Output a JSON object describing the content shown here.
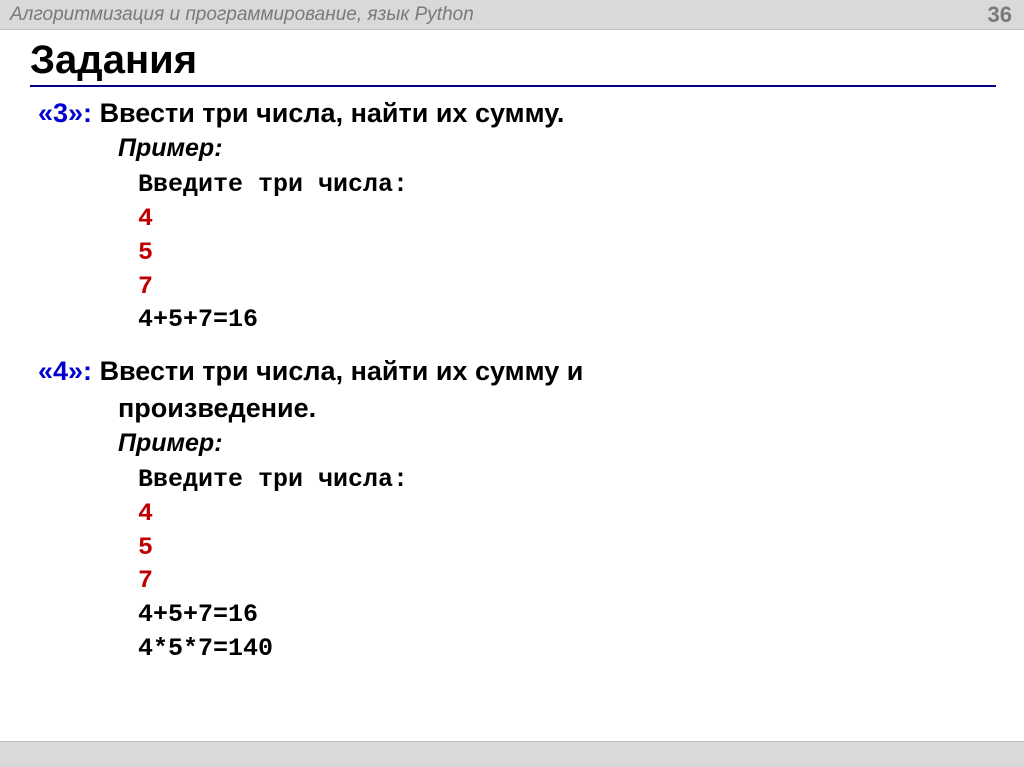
{
  "header": {
    "title": "Алгоритмизация и программирование, язык Python",
    "page_number": "36"
  },
  "heading": "Задания",
  "tasks": [
    {
      "label": "«3»:",
      "desc": "Ввести три числа, найти их сумму.",
      "desc_cont": "",
      "example_label": "Пример:",
      "code": {
        "prompt": "Введите три числа:",
        "inputs": [
          "4",
          "5",
          "7"
        ],
        "outputs": [
          "4+5+7=16"
        ]
      }
    },
    {
      "label": "«4»:",
      "desc": "Ввести три числа, найти их сумму и",
      "desc_cont": "произведение.",
      "example_label": "Пример:",
      "code": {
        "prompt": "Введите три числа:",
        "inputs": [
          "4",
          "5",
          "7"
        ],
        "outputs": [
          "4+5+7=16",
          "4*5*7=140"
        ]
      }
    }
  ]
}
